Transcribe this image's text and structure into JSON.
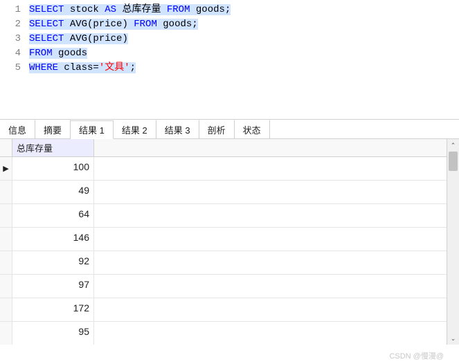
{
  "editor": {
    "lines": [
      {
        "num": "1",
        "tokens": [
          {
            "t": "SELECT",
            "c": "kw",
            "s": true
          },
          {
            "t": " ",
            "c": "id",
            "s": true
          },
          {
            "t": "stock",
            "c": "id",
            "s": true
          },
          {
            "t": " ",
            "c": "id",
            "s": true
          },
          {
            "t": "AS",
            "c": "kw",
            "s": true
          },
          {
            "t": " ",
            "c": "id",
            "s": true
          },
          {
            "t": "总库存量",
            "c": "id",
            "s": true
          },
          {
            "t": " ",
            "c": "id",
            "s": true
          },
          {
            "t": "FROM",
            "c": "kw",
            "s": true
          },
          {
            "t": " ",
            "c": "id",
            "s": true
          },
          {
            "t": "goods;",
            "c": "id",
            "s": true
          }
        ]
      },
      {
        "num": "2",
        "tokens": [
          {
            "t": "SELECT",
            "c": "kw",
            "s": true
          },
          {
            "t": " ",
            "c": "id",
            "s": true
          },
          {
            "t": "AVG(price)",
            "c": "id",
            "s": true
          },
          {
            "t": " ",
            "c": "id",
            "s": true
          },
          {
            "t": "FROM",
            "c": "kw",
            "s": true
          },
          {
            "t": " ",
            "c": "id",
            "s": true
          },
          {
            "t": "goods;",
            "c": "id",
            "s": true
          }
        ]
      },
      {
        "num": "3",
        "tokens": [
          {
            "t": "SELECT",
            "c": "kw",
            "s": true
          },
          {
            "t": " ",
            "c": "id",
            "s": true
          },
          {
            "t": "AVG(price)",
            "c": "id",
            "s": true
          }
        ]
      },
      {
        "num": "4",
        "tokens": [
          {
            "t": "FROM",
            "c": "kw",
            "s": true
          },
          {
            "t": " ",
            "c": "id",
            "s": true
          },
          {
            "t": "goods",
            "c": "id",
            "s": true
          }
        ]
      },
      {
        "num": "5",
        "tokens": [
          {
            "t": "WHERE",
            "c": "kw",
            "s": true
          },
          {
            "t": " ",
            "c": "id",
            "s": true
          },
          {
            "t": "class=",
            "c": "id",
            "s": true
          },
          {
            "t": "'文具'",
            "c": "str",
            "s": true
          },
          {
            "t": ";",
            "c": "id",
            "s": true
          }
        ]
      }
    ]
  },
  "tabs": [
    {
      "label": "信息",
      "active": false
    },
    {
      "label": "摘要",
      "active": false
    },
    {
      "label": "结果 1",
      "active": true
    },
    {
      "label": "结果 2",
      "active": false
    },
    {
      "label": "结果 3",
      "active": false
    },
    {
      "label": "剖析",
      "active": false
    },
    {
      "label": "状态",
      "active": false
    }
  ],
  "results": {
    "column": "总库存量",
    "rows": [
      {
        "value": "100",
        "current": true
      },
      {
        "value": "49",
        "current": false
      },
      {
        "value": "64",
        "current": false
      },
      {
        "value": "146",
        "current": false
      },
      {
        "value": "92",
        "current": false
      },
      {
        "value": "97",
        "current": false
      },
      {
        "value": "172",
        "current": false
      },
      {
        "value": "95",
        "current": false
      }
    ]
  },
  "scroll": {
    "up": "⌃",
    "down": "⌄"
  },
  "watermark": "CSDN @慢漫@"
}
